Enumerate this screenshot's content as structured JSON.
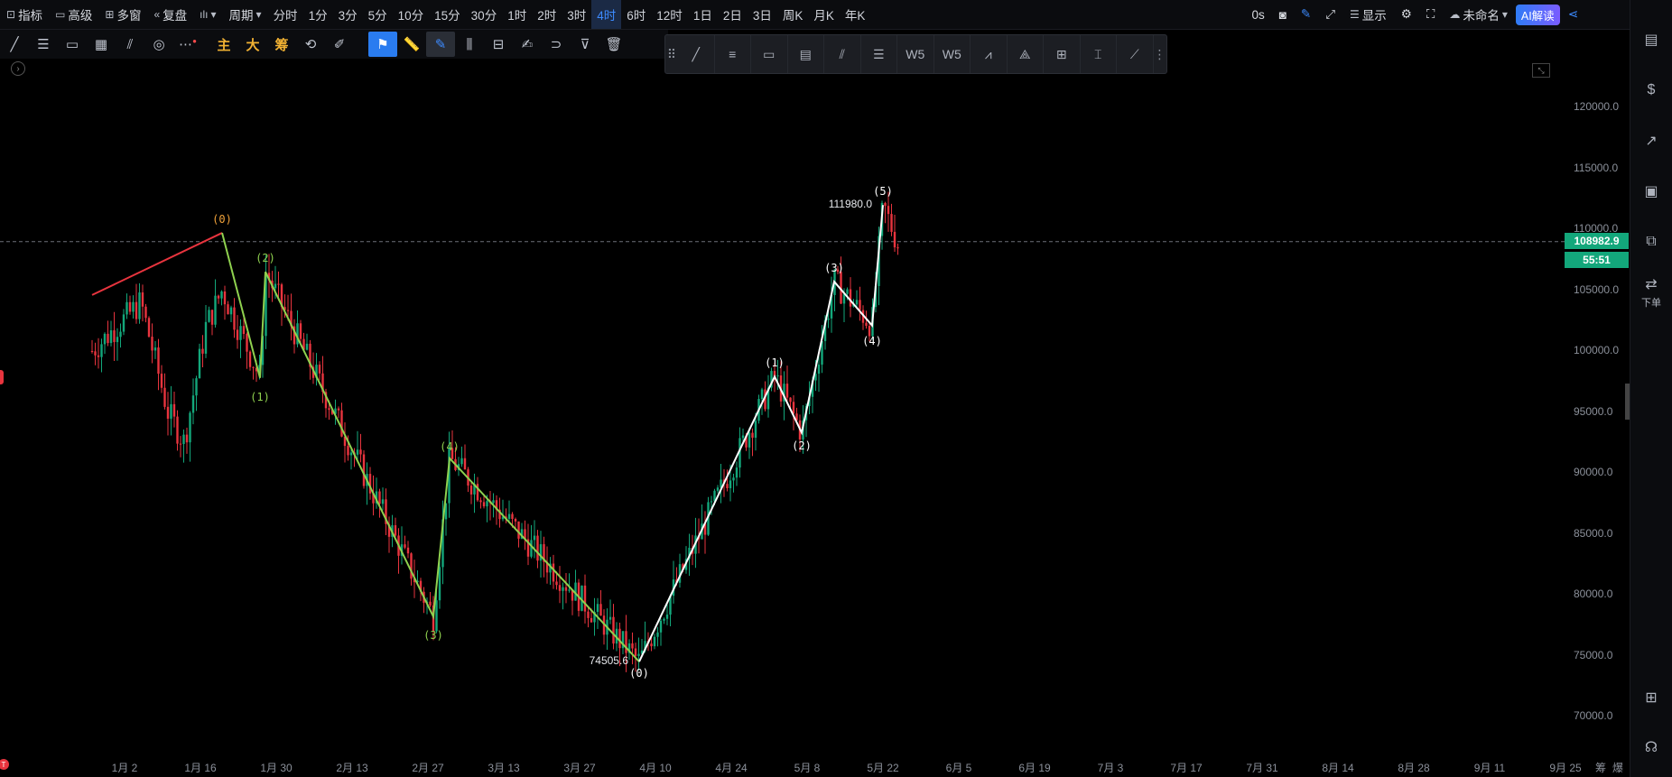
{
  "topbar": {
    "indicators": "指标",
    "advanced": "高级",
    "multi_window": "多窗",
    "replay": "复盘",
    "period_menu": "周期",
    "periods": [
      "分时",
      "1分",
      "3分",
      "5分",
      "10分",
      "15分",
      "30分",
      "1时",
      "2时",
      "3时",
      "4时",
      "6时",
      "12时",
      "1日",
      "2日",
      "3日",
      "周K",
      "月K",
      "年K"
    ],
    "active_period": "4时",
    "countdown": "0s",
    "display": "显示",
    "layout_name": "未命名",
    "ai_button": "AI解读"
  },
  "toolbar2": {
    "main_label": "主",
    "big_label": "大",
    "chip_label": "筹"
  },
  "right_sidebar": {
    "order_label": "下单"
  },
  "price_axis": {
    "ticks": [
      "120000.0",
      "115000.0",
      "110000.0",
      "105000.0",
      "100000.0",
      "95000.0",
      "90000.0",
      "85000.0",
      "80000.0",
      "75000.0",
      "70000.0"
    ],
    "current_price": "108982.9",
    "bar_countdown": "55:51",
    "current_color": "#13a77b"
  },
  "time_axis": {
    "ticks": [
      "1月 2",
      "1月 16",
      "1月 30",
      "2月 13",
      "2月 27",
      "3月 13",
      "3月 27",
      "4月 10",
      "4月 24",
      "5月 8",
      "5月 22",
      "6月 5",
      "6月 19",
      "7月 3",
      "7月 17",
      "7月 31",
      "8月 14",
      "8月 28",
      "9月 11",
      "9月 25"
    ],
    "right_labels": [
      "筹",
      "爆"
    ]
  },
  "annotations": {
    "high_price": "111980.0",
    "low_price": "74505.6",
    "red_wave": [
      "(0)"
    ],
    "green_wave": [
      "(1)",
      "(2)",
      "(3)",
      "(4)"
    ],
    "white_wave": [
      "(0)",
      "(1)",
      "(2)",
      "(3)",
      "(4)",
      "(5)"
    ],
    "colors": {
      "red": "#e8343e",
      "green": "#8fd14f",
      "white": "#ffffff",
      "orange": "#f2a33a"
    }
  },
  "chart_data": {
    "type": "candlestick",
    "instrument_period": "4时",
    "ylim": [
      68000,
      123500
    ],
    "y_ticks": [
      70000,
      75000,
      80000,
      85000,
      90000,
      95000,
      100000,
      105000,
      110000,
      115000,
      120000
    ],
    "x_ticks": [
      "1月 2",
      "1月 16",
      "1月 30",
      "2月 13",
      "2月 27",
      "3月 13",
      "3月 27",
      "4月 10",
      "4月 24",
      "5月 8",
      "5月 22",
      "6月 5",
      "6月 19",
      "7月 3",
      "7月 17",
      "7月 31",
      "8月 14",
      "8月 28",
      "9月 11",
      "9月 25"
    ],
    "last_price": 108982.9,
    "annotated_high": 111980.0,
    "annotated_low": 74505.6,
    "red_line": [
      {
        "x": "12月 25",
        "y": 104600
      },
      {
        "x": "1月 20",
        "y": 109700
      }
    ],
    "green_wave": [
      {
        "label": "(0)",
        "x": "1月 20",
        "y": 109700
      },
      {
        "label": "(1)",
        "x": "1月 27",
        "y": 97800
      },
      {
        "label": "(2)",
        "x": "1月 28",
        "y": 106500
      },
      {
        "label": "(3)",
        "x": "2月 28",
        "y": 78200
      },
      {
        "label": "(4)",
        "x": "3月 3",
        "y": 91200
      },
      {
        "label": "(0)",
        "x": "4月 7",
        "y": 74505.6
      }
    ],
    "white_wave": [
      {
        "label": "(0)",
        "x": "4月 7",
        "y": 74505.6
      },
      {
        "label": "(1)",
        "x": "5月 2",
        "y": 97900
      },
      {
        "label": "(2)",
        "x": "5月 7",
        "y": 93300
      },
      {
        "label": "(3)",
        "x": "5月 13",
        "y": 105700
      },
      {
        "label": "(4)",
        "x": "5月 20",
        "y": 102100
      },
      {
        "label": "(5)",
        "x": "5月 22",
        "y": 111980
      }
    ]
  }
}
